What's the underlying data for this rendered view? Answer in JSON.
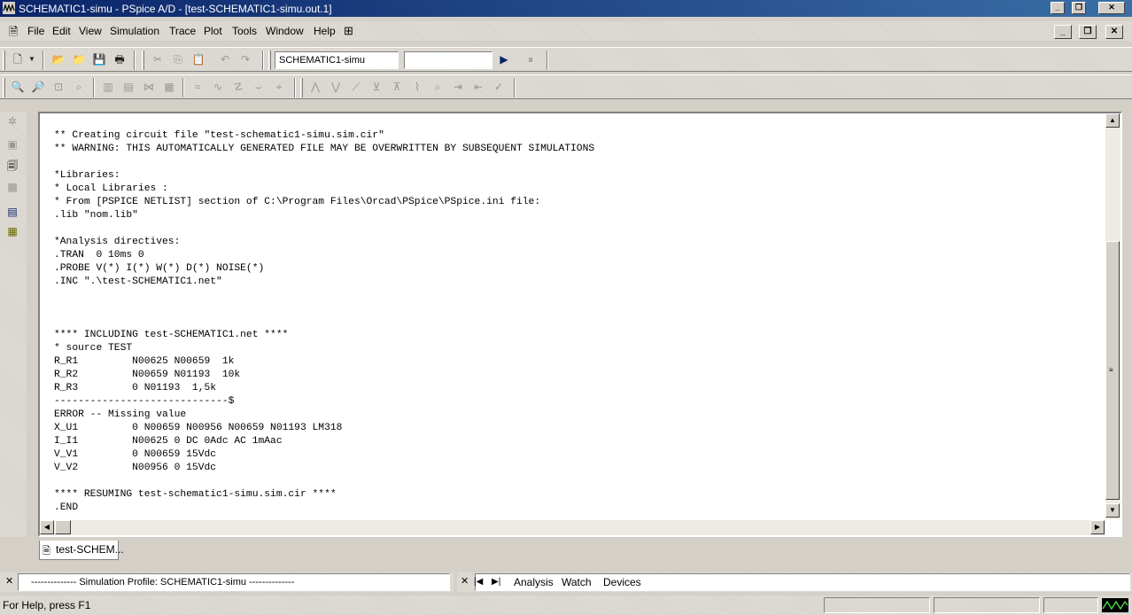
{
  "window": {
    "title": "SCHEMATIC1-simu - PSpice A/D  - [test-SCHEMATIC1-simu.out.1]",
    "caption_buttons": [
      "_",
      "❐",
      "✕"
    ],
    "mdi_buttons": [
      "_",
      "❐",
      "✕"
    ]
  },
  "menu": {
    "items": [
      "File",
      "Edit",
      "View",
      "Simulation",
      "Trace",
      "Plot",
      "Tools",
      "Window",
      "Help"
    ]
  },
  "toolbar": {
    "profile_value": "SCHEMATIC1-simu",
    "second_combo_value": ""
  },
  "document": {
    "lines": [
      "** Creating circuit file \"test-schematic1-simu.sim.cir\"",
      "** WARNING: THIS AUTOMATICALLY GENERATED FILE MAY BE OVERWRITTEN BY SUBSEQUENT SIMULATIONS",
      "",
      "*Libraries:",
      "* Local Libraries :",
      "* From [PSPICE NETLIST] section of C:\\Program Files\\Orcad\\PSpice\\PSpice.ini file:",
      ".lib \"nom.lib\"",
      "",
      "*Analysis directives:",
      ".TRAN  0 10ms 0",
      ".PROBE V(*) I(*) W(*) D(*) NOISE(*)",
      ".INC \".\\test-SCHEMATIC1.net\"",
      "",
      "",
      "",
      "**** INCLUDING test-SCHEMATIC1.net ****",
      "* source TEST",
      "R_R1         N00625 N00659  1k",
      "R_R2         N00659 N01193  10k",
      "R_R3         0 N01193  1,5k",
      "-----------------------------$",
      "ERROR -- Missing value",
      "X_U1         0 N00659 N00956 N00659 N01193 LM318",
      "I_I1         N00625 0 DC 0Adc AC 1mAac",
      "V_V1         0 N00659 15Vdc",
      "V_V2         N00956 0 15Vdc",
      "",
      "**** RESUMING test-schematic1-simu.sim.cir ****",
      ".END",
      ""
    ]
  },
  "tab": {
    "label": "test-SCHEM..."
  },
  "bottom": {
    "profile_text": "-------------- Simulation Profile:  SCHEMATIC1-simu --------------",
    "tabs": [
      "Analysis",
      "Watch",
      "Devices"
    ]
  },
  "status": {
    "text": "For Help, press F1"
  },
  "colors": {
    "title_bar": "#0a246a",
    "face": "#d4d0c8"
  }
}
